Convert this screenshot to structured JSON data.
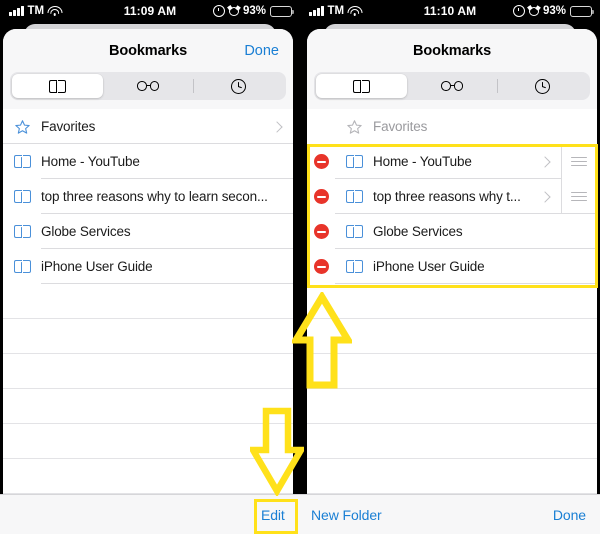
{
  "meta": {
    "accent_blue": "#1a7fd4",
    "highlight_yellow": "#ffe11a",
    "delete_red": "#e8342a",
    "book_icon_blue": "#4a90d9"
  },
  "status_bar_left": {
    "signal_icon": "cellular-bars-icon",
    "carrier": "TM",
    "wifi_icon": "wifi-icon",
    "time": "11:09 AM",
    "location_icon": "location-services-icon",
    "alarm_icon": "alarm-clock-icon",
    "battery_percent": "93%",
    "battery_icon": "battery-icon"
  },
  "status_bar_right": {
    "signal_icon": "cellular-bars-icon",
    "carrier": "TM",
    "wifi_icon": "wifi-icon",
    "time": "11:10 AM",
    "location_icon": "location-services-icon",
    "alarm_icon": "alarm-clock-icon",
    "battery_percent": "93%",
    "battery_icon": "battery-icon"
  },
  "left_panel": {
    "nav": {
      "title": "Bookmarks",
      "done_label": "Done"
    },
    "segments": [
      {
        "name": "bookmarks",
        "icon": "open-book-icon",
        "selected": true
      },
      {
        "name": "reading-list",
        "icon": "reading-glasses-icon",
        "selected": false
      },
      {
        "name": "history",
        "icon": "clock-icon",
        "selected": false
      }
    ],
    "rows": [
      {
        "label": "Favorites",
        "icon": "star-icon",
        "chevron": true,
        "muted": false
      },
      {
        "label": "Home - YouTube",
        "icon": "open-book-icon",
        "chevron": false,
        "muted": false
      },
      {
        "label": "top three reasons why to learn secon...",
        "icon": "open-book-icon",
        "chevron": false,
        "muted": false
      },
      {
        "label": "Globe Services",
        "icon": "open-book-icon",
        "chevron": false,
        "muted": false
      },
      {
        "label": "iPhone User Guide",
        "icon": "open-book-icon",
        "chevron": false,
        "muted": false
      }
    ]
  },
  "right_panel": {
    "nav": {
      "title": "Bookmarks",
      "done_label": ""
    },
    "segments": [
      {
        "name": "bookmarks",
        "icon": "open-book-icon",
        "selected": true
      },
      {
        "name": "reading-list",
        "icon": "reading-glasses-icon",
        "selected": false
      },
      {
        "name": "history",
        "icon": "clock-icon",
        "selected": false
      }
    ],
    "favorites_row": {
      "label": "Favorites",
      "icon": "star-icon",
      "muted": true
    },
    "edit_rows": [
      {
        "label": "Home - YouTube",
        "icon": "open-book-icon",
        "delete_icon": "delete-minus-icon",
        "chevron": true,
        "reorder_icon": "reorder-handle-icon"
      },
      {
        "label": "top three reasons why t...",
        "icon": "open-book-icon",
        "delete_icon": "delete-minus-icon",
        "chevron": true,
        "reorder_icon": "reorder-handle-icon"
      },
      {
        "label": "Globe Services",
        "icon": "open-book-icon",
        "delete_icon": "delete-minus-icon",
        "chevron": false,
        "reorder_icon": ""
      },
      {
        "label": "iPhone User Guide",
        "icon": "open-book-icon",
        "delete_icon": "delete-minus-icon",
        "chevron": false,
        "reorder_icon": ""
      }
    ]
  },
  "toolbar": {
    "edit_label": "Edit",
    "new_folder_label": "New Folder",
    "done_label": "Done"
  },
  "annotations": {
    "highlight_rows_name": "edit-rows-highlight",
    "highlight_edit_name": "edit-button-highlight",
    "arrow_up_name": "arrow-up-annotation",
    "arrow_down_name": "arrow-down-annotation"
  }
}
